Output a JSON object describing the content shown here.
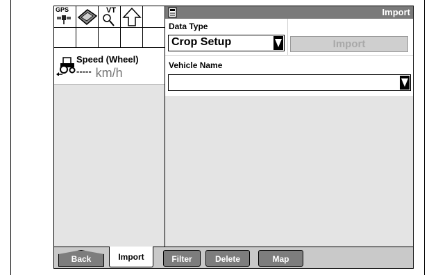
{
  "status_icons": {
    "gps_label": "GPS",
    "vt_label": "VT"
  },
  "speed": {
    "label": "Speed (Wheel)",
    "value": "-----",
    "unit": "km/h"
  },
  "panel": {
    "title": "Import",
    "data_type_label": "Data Type",
    "data_type_value": "Crop Setup",
    "import_button": "Import",
    "vehicle_name_label": "Vehicle Name",
    "vehicle_name_value": ""
  },
  "tabs": {
    "back": "Back",
    "import": "Import",
    "filter": "Filter",
    "delete": "Delete",
    "map": "Map"
  }
}
